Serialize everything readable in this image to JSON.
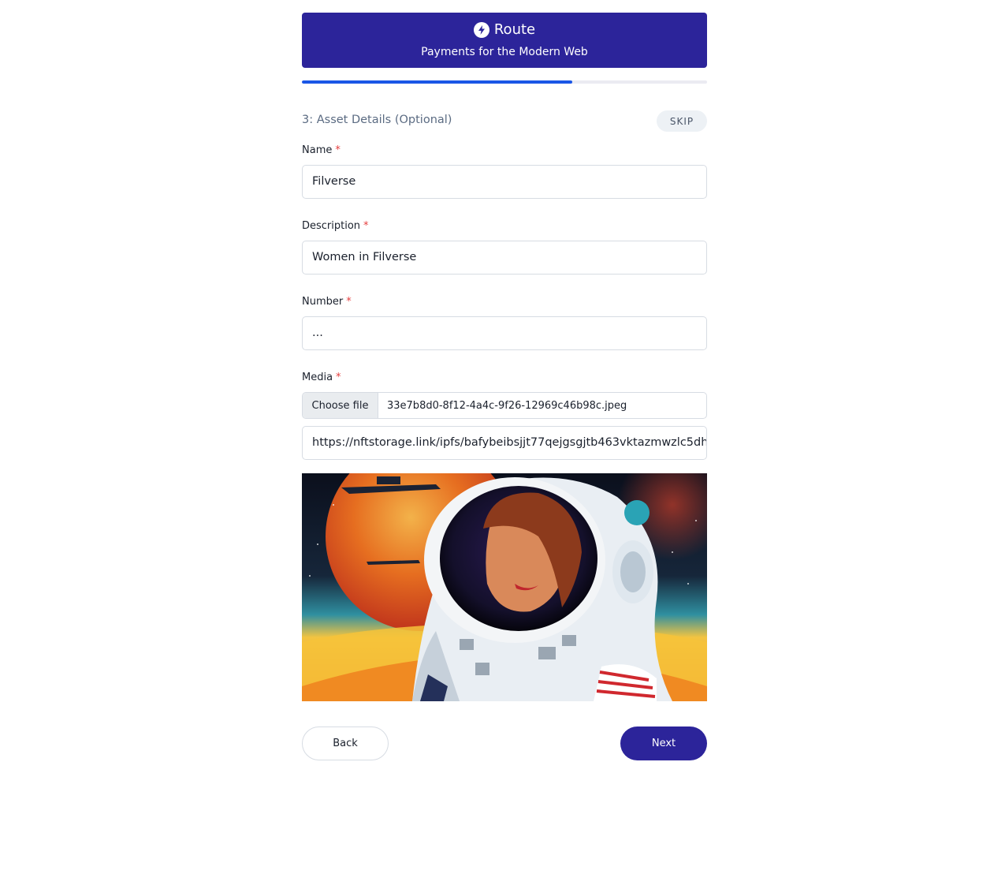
{
  "brand": {
    "name": "Route",
    "tagline": "Payments for the Modern Web",
    "icon": "lightning-bolt-icon",
    "color": "#2c249a"
  },
  "progress": {
    "value": 0.667,
    "color": "#1a56e6"
  },
  "step": {
    "title": "3: Asset Details (Optional)",
    "skip_label": "SKIP"
  },
  "form": {
    "name": {
      "label": "Name",
      "required_mark": "*",
      "value": "Filverse"
    },
    "description": {
      "label": "Description",
      "required_mark": "*",
      "value": "Women in Filverse"
    },
    "number": {
      "label": "Number",
      "required_mark": "*",
      "value": "..."
    },
    "media": {
      "label": "Media",
      "required_mark": "*",
      "choose_label": "Choose file",
      "file_name": "33e7b8d0-8f12-4a4c-9f26-12969c46b98c.jpeg",
      "url": "https://nftstorage.link/ipfs/bafybeibsjjt77qejgsgjtb463vktazmwzlc5dh"
    }
  },
  "buttons": {
    "back": "Back",
    "next": "Next"
  }
}
